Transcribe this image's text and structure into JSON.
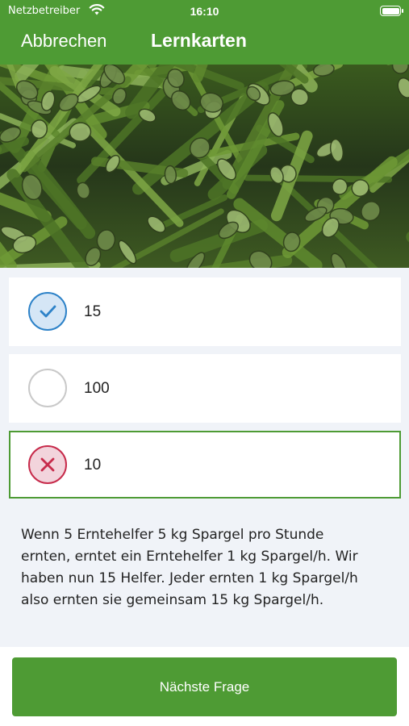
{
  "status_bar": {
    "carrier": "Netzbetreiber",
    "time": "16:10"
  },
  "nav": {
    "cancel_label": "Abbrechen",
    "title": "Lernkarten"
  },
  "answers": [
    {
      "label": "15",
      "state": "correct"
    },
    {
      "label": "100",
      "state": "unselected"
    },
    {
      "label": "10",
      "state": "wrong-selected"
    }
  ],
  "explanation": "Wenn 5 Erntehelfer 5 kg Spargel pro Stunde ernten, erntet ein Erntehelfer 1 kg Spargel/h. Wir haben nun 15 Helfer. Jeder ernten 1 kg Spargel/h also ernten sie gemeinsam 15 kg Spargel/h.",
  "next_button_label": "Nächste Frage",
  "colors": {
    "brand_green": "#4e9b34",
    "correct_blue": "#2d82c8",
    "wrong_red": "#c72b4b",
    "background": "#f0f3f8"
  },
  "icons": {
    "signal": "wifi-icon",
    "battery": "battery-icon",
    "correct": "checkmark-icon",
    "wrong": "x-icon",
    "photo": "asparagus-photo"
  }
}
